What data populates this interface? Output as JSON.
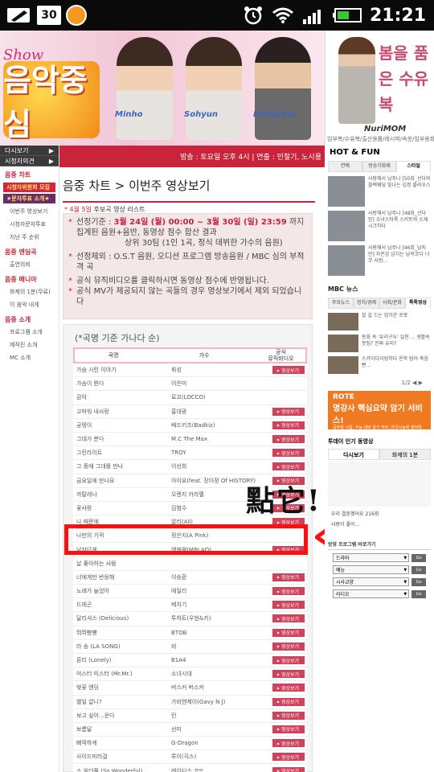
{
  "status_bar": {
    "badge": "30",
    "time": "21:21"
  },
  "banner": {
    "show_text": "Show",
    "logo_text": "음악중심",
    "people_tags": [
      "Minho",
      "Sohyun",
      "Hongchul"
    ]
  },
  "ad": {
    "text": "봄을 품은 수유복",
    "brand": "NuriMOM",
    "foot": "임부복/수유복/출산용품/레시피/속옷/임부용화장"
  },
  "navbar": {
    "info": "방송 : 토요일 오후 4시  |  연출 : 민철기, 노시용"
  },
  "sidebar": {
    "items": [
      {
        "label": "다시보기",
        "type": "dark"
      },
      {
        "label": "시청자의견",
        "type": "dark"
      },
      {
        "label": "음중 차트",
        "type": "section"
      },
      {
        "label": "시청자위원회 모집",
        "type": "red"
      },
      {
        "label": "★문자투표 소개★",
        "type": "purple"
      },
      {
        "label": "이번주 영상보기",
        "type": "item"
      },
      {
        "label": "시청자문자투표",
        "type": "item"
      },
      {
        "label": "지난 주 순위",
        "type": "item"
      },
      {
        "label": "음중 엔딩곡",
        "type": "section"
      },
      {
        "label": "출연의뢰",
        "type": "item"
      },
      {
        "label": "음중 매니아",
        "type": "section"
      },
      {
        "label": "화제의 1분(무료)",
        "type": "item"
      },
      {
        "label": "이 음악 내게",
        "type": "item"
      },
      {
        "label": "음중 소개",
        "type": "section"
      },
      {
        "label": "프로그램 소개",
        "type": "item"
      },
      {
        "label": "제작진 소개",
        "type": "item"
      },
      {
        "label": "MC 소개",
        "type": "item"
      }
    ]
  },
  "main": {
    "title": "음중 차트 > 이번주 영상보기",
    "subhead": {
      "date": "4월 5일",
      "rest": "후보곡 영상 리스트"
    },
    "info": [
      {
        "pre": "선정기준 : ",
        "hl": "3월 24일 (월) 00:00 ~ 3월 30일 (일) 23:59",
        "post": " 까지 집계된 음원+음반, 동영상 점수 합산 결과"
      },
      {
        "pre": "상위 30팀 (1인 1곡, 정식 데뷔한 가수의 음원)",
        "hl": "",
        "post": "",
        "nobullet": true
      },
      {
        "pre": "선정제외 : O.S.T 음원, 오디션 프로그램 방송음원 / MBC 심의 부적격 곡",
        "hl": "",
        "post": ""
      },
      {
        "pre": "공식 뮤직비디오를 클릭하시면 동영상 점수에 반영됩니다.",
        "hl": "",
        "post": ""
      },
      {
        "pre": "공식 MV가 제공되지 않는 곡들의 경우 영상보기에서 제외 되었습니다",
        "hl": "",
        "post": ""
      }
    ],
    "list_caption": "(*곡명 기준 가나다 순)",
    "headers": {
      "song": "곡명",
      "artist": "가수",
      "official": "공식\n뮤직비디오"
    },
    "video_label": "영상보기",
    "rows": [
      {
        "song": "가슴 시린 이야기",
        "artist": "휘성",
        "btn": true
      },
      {
        "song": "가슴이 뛴다",
        "artist": "이은미",
        "btn": false
      },
      {
        "song": "감아",
        "artist": "로꼬(LOCCO)",
        "btn": false
      },
      {
        "song": "고마워 내사랑",
        "artist": "홍대광",
        "btn": true
      },
      {
        "song": "궁뎅이",
        "artist": "배드키즈(Badkiz)",
        "btn": true
      },
      {
        "song": "그대가 분다",
        "artist": "M.C The Max",
        "btn": true
      },
      {
        "song": "그린라이트",
        "artist": "TROY",
        "btn": true
      },
      {
        "song": "그 중에 그대를 만나",
        "artist": "이선희",
        "btn": true
      },
      {
        "song": "금요일에 만나요",
        "artist": "아이유(feat. 장이정 Of HISTORY)",
        "btn": true
      },
      {
        "song": "까탈레나",
        "artist": "오렌지 카라멜",
        "btn": true
      },
      {
        "song": "꽃사랑",
        "artist": "김범수",
        "btn": true
      },
      {
        "song": "나 때문에",
        "artist": "알리(Ali)",
        "btn": true
      },
      {
        "song": "나만의 기적",
        "artist": "정은지(A Pink)",
        "btn": false
      },
      {
        "song": "남자답게",
        "artist": "엠블랙(MBLAQ)",
        "btn": true
      },
      {
        "song": "날 좋아하는 사람",
        "artist": "",
        "btn": false
      },
      {
        "song": "너에게만 반응해",
        "artist": "이승환",
        "btn": true
      },
      {
        "song": "노래가 늘었어",
        "artist": "에일리",
        "btn": true
      },
      {
        "song": "드레곤",
        "artist": "베치기",
        "btn": true
      },
      {
        "song": "달리셔스 (Delicious)",
        "artist": "투하트(우현&키)",
        "btn": true
      },
      {
        "song": "뛰뛰빵빵",
        "artist": "BTOB",
        "btn": true
      },
      {
        "song": "라 송 (LA SONG)",
        "artist": "비",
        "btn": true
      },
      {
        "song": "론리 (Lonely)",
        "artist": "B1A4",
        "btn": true
      },
      {
        "song": "미스터 미스터 (Mr.Mr.)",
        "artist": "소녀시대",
        "btn": true
      },
      {
        "song": "벚꽃 엔딩",
        "artist": "버스커 버스커",
        "btn": true
      },
      {
        "song": "별일 없니?",
        "artist": "가비엔제이(Gavy N J)",
        "btn": true
      },
      {
        "song": "보고 싶어...운다",
        "artist": "린",
        "btn": true
      },
      {
        "song": "보름달",
        "artist": "선미",
        "btn": true
      },
      {
        "song": "삐딱하게",
        "artist": "G-Dragon",
        "btn": true
      },
      {
        "song": "사이드미러걸",
        "artist": "루이(긱스)",
        "btn": true
      },
      {
        "song": "소 원더풀 (So Wonderful)",
        "artist": "레이디스 코드",
        "btn": true
      },
      {
        "song": "송소리",
        "artist": "S.M. THE BALLAD",
        "btn": true
      }
    ]
  },
  "annotation": {
    "text": "點它!!"
  },
  "right": {
    "hotfun_title": "HOT & FUN",
    "tabs": [
      "연예",
      "방송가화제",
      "스타일"
    ],
    "active_tab": 2,
    "news": [
      {
        "text": "사랑해서 남주나 [50회_선다와 블랙웨딩 빛나는 김정 블라우스"
      },
      {
        "text": "사랑해서 남주나 [48회_선다인] 소녀스타룩 스커트와 소재 시크하다"
      },
      {
        "text": "사랑해서 남주나 [46회_남지인] 자존감 넘치는 남의코디 너무 사랑..."
      }
    ],
    "mbc_title": "MBC 뉴스",
    "mbc_tabs": [
      "주요뉴스",
      "정치/경제",
      "사회/문화",
      "톡톡영상"
    ],
    "mbc_items": [
      {
        "text": "잘 걸 드는 엄거운 로봇"
      },
      {
        "text": "동화 속 '유리구두' 실현 ... 생활속 뭇집? 진짜 유리?"
      },
      {
        "text": "스카이다이빙하다 온작 텀어 죽음 빤..."
      }
    ],
    "pager": "1/2",
    "rote": {
      "logo": "ROTE",
      "big": "명강사 핵심요약 암기 서비스!",
      "sm": "공무원 시험, 수능 대비 암기 부터, 한국사능력 영어학습/ 사전 암기까지!"
    },
    "popular_title": "투데이 인기 동영상",
    "ptabs": [
      "다시보기",
      "화제의 1분"
    ],
    "ptext": "우리 결혼했어요 216회",
    "ptext2": "사랑이 좋아...",
    "prog_title": "방영 프로그램 바로가기",
    "selects": [
      "드라마",
      "예능",
      "시사교양",
      "라디오"
    ],
    "go_label": "Go"
  }
}
